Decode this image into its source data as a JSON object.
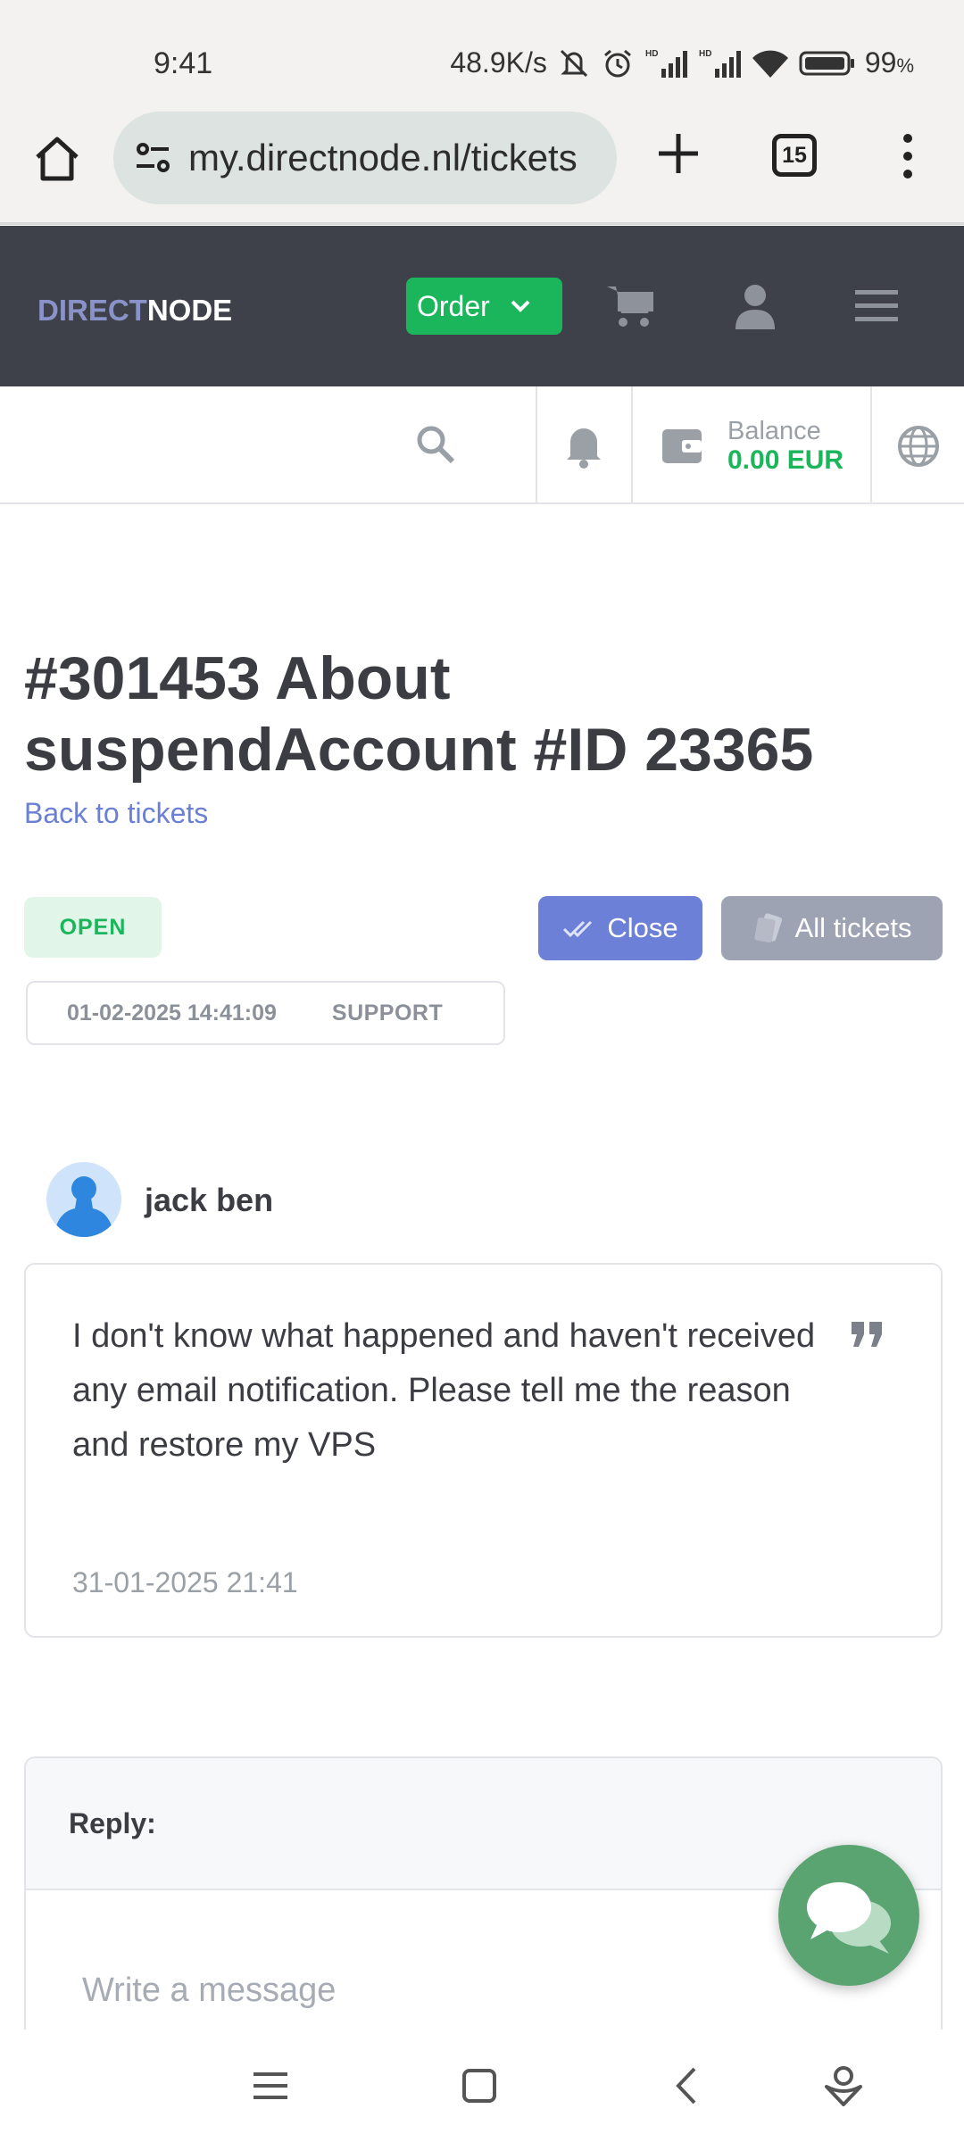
{
  "status_bar": {
    "time": "9:41",
    "network_speed": "48.9K/s",
    "battery": "99",
    "battery_unit": "%",
    "icons": [
      "mute-icon",
      "alarm-icon",
      "hd-signal-icon",
      "hd-signal-icon",
      "wifi-icon",
      "battery-icon"
    ]
  },
  "browser": {
    "url": "my.directnode.nl/tickets",
    "tab_count": "15",
    "icons": [
      "home-icon",
      "site-settings-icon",
      "plus-icon",
      "tabs-icon",
      "more-vertical-icon"
    ]
  },
  "site_header": {
    "logo_part1": "DIRECT",
    "logo_part2": "NODE",
    "order_label": "Order",
    "icons": [
      "cart-icon",
      "user-icon",
      "hamburger-menu-icon"
    ],
    "colors": {
      "header_bg": "#3e4149",
      "order_green": "#1bb55c"
    }
  },
  "sub_bar": {
    "balance_label": "Balance",
    "balance_value": "0.00 EUR",
    "icons": [
      "search-icon",
      "bell-icon",
      "wallet-icon",
      "globe-icon"
    ]
  },
  "ticket": {
    "title": "#301453 About suspendAccount #ID 23365",
    "back_link": "Back to tickets",
    "status": "OPEN",
    "close_label": "Close",
    "all_tickets_label": "All tickets",
    "date": "01-02-2025 14:41:09",
    "department": "SUPPORT",
    "colors": {
      "close_btn": "#6b80d6",
      "all_tickets_btn": "#9da3b3",
      "link": "#6b7fd3"
    }
  },
  "message": {
    "author": "jack ben",
    "text": "I don't know what happened and haven't received any email notification. Please tell me the reason and restore my VPS",
    "timestamp": "31-01-2025 21:41"
  },
  "reply": {
    "label": "Reply:",
    "placeholder": "Write a message"
  },
  "nav_bar": {
    "icons": [
      "recents-menu-icon",
      "home-square-icon",
      "back-chevron-icon",
      "assistant-icon"
    ]
  }
}
